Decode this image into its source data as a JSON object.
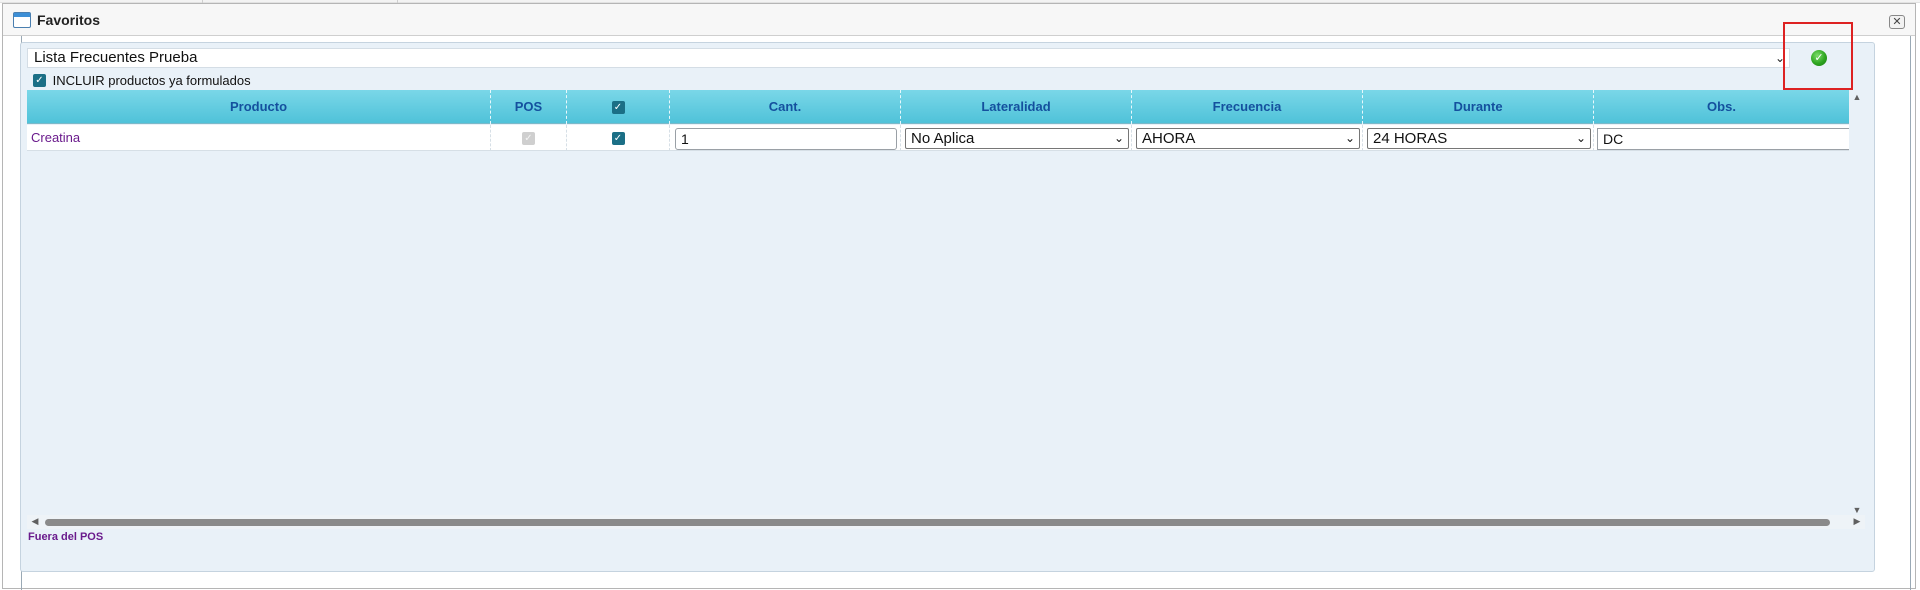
{
  "window": {
    "title": "Favoritos",
    "close_glyph": "✕",
    "icon": "window-icon"
  },
  "list": {
    "selected": "Lista Frecuentes Prueba",
    "confirm_icon": "check-circle-icon"
  },
  "include": {
    "checked": true,
    "label": "INCLUIR productos ya formulados"
  },
  "grid": {
    "columns": [
      {
        "key": "producto",
        "label": "Producto"
      },
      {
        "key": "pos",
        "label": "POS"
      },
      {
        "key": "select",
        "label": ""
      },
      {
        "key": "cant",
        "label": "Cant."
      },
      {
        "key": "lateralidad",
        "label": "Lateralidad"
      },
      {
        "key": "frecuencia",
        "label": "Frecuencia"
      },
      {
        "key": "durante",
        "label": "Durante"
      },
      {
        "key": "obs",
        "label": "Obs."
      }
    ],
    "header_select_checked": true,
    "rows": [
      {
        "producto": "Creatina",
        "pos_checked": true,
        "pos_disabled": true,
        "selected": true,
        "cant": "1",
        "lateralidad": "No Aplica",
        "frecuencia": "AHORA",
        "durante": "24 HORAS",
        "obs": "DC"
      }
    ]
  },
  "legend": {
    "fuera_pos": "Fuera del POS"
  },
  "colors": {
    "header_gradient_top": "#7ad7e8",
    "header_text": "#14509e",
    "non_pos_text": "#6a1a8c",
    "panel_bg": "#e9f1f8",
    "highlight": "#dd2222"
  }
}
